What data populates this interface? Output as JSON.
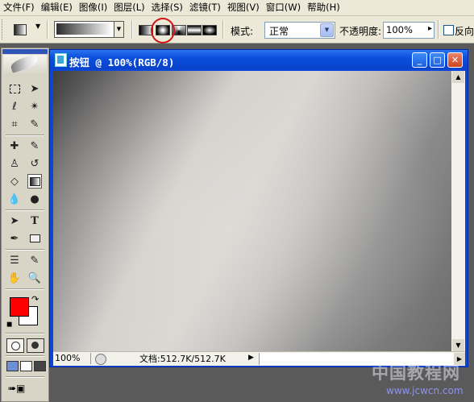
{
  "menu": [
    "文件(F)",
    "编辑(E)",
    "图像(I)",
    "图层(L)",
    "选择(S)",
    "滤镜(T)",
    "视图(V)",
    "窗口(W)",
    "帮助(H)"
  ],
  "options": {
    "mode_label": "模式:",
    "mode_value": "正常",
    "opacity_label": "不透明度:",
    "opacity_value": "100%",
    "reverse_label": "反向",
    "gradient_types": [
      "linear",
      "radial",
      "angle",
      "reflected",
      "diamond"
    ],
    "highlighted_type": "radial"
  },
  "document": {
    "title": "按钮 @ 100%(RGB/8)",
    "zoom": "100%",
    "doc_size": "文档:512.7K/512.7K"
  },
  "tools": [
    "rectangular-marquee",
    "move",
    "lasso",
    "magic-wand",
    "crop",
    "slice",
    "healing-brush",
    "brush",
    "clone-stamp",
    "history-brush",
    "eraser",
    "gradient",
    "blur",
    "dodge",
    "path-selection",
    "type",
    "pen",
    "rectangle-shape",
    "notes",
    "eyedropper",
    "hand",
    "zoom"
  ],
  "colors": {
    "foreground": "#ff0000",
    "background": "#ffffff",
    "highlight_circle": "#d01515"
  },
  "watermark": {
    "main": "中国教程网",
    "sub": "www.jcwcn.com"
  }
}
